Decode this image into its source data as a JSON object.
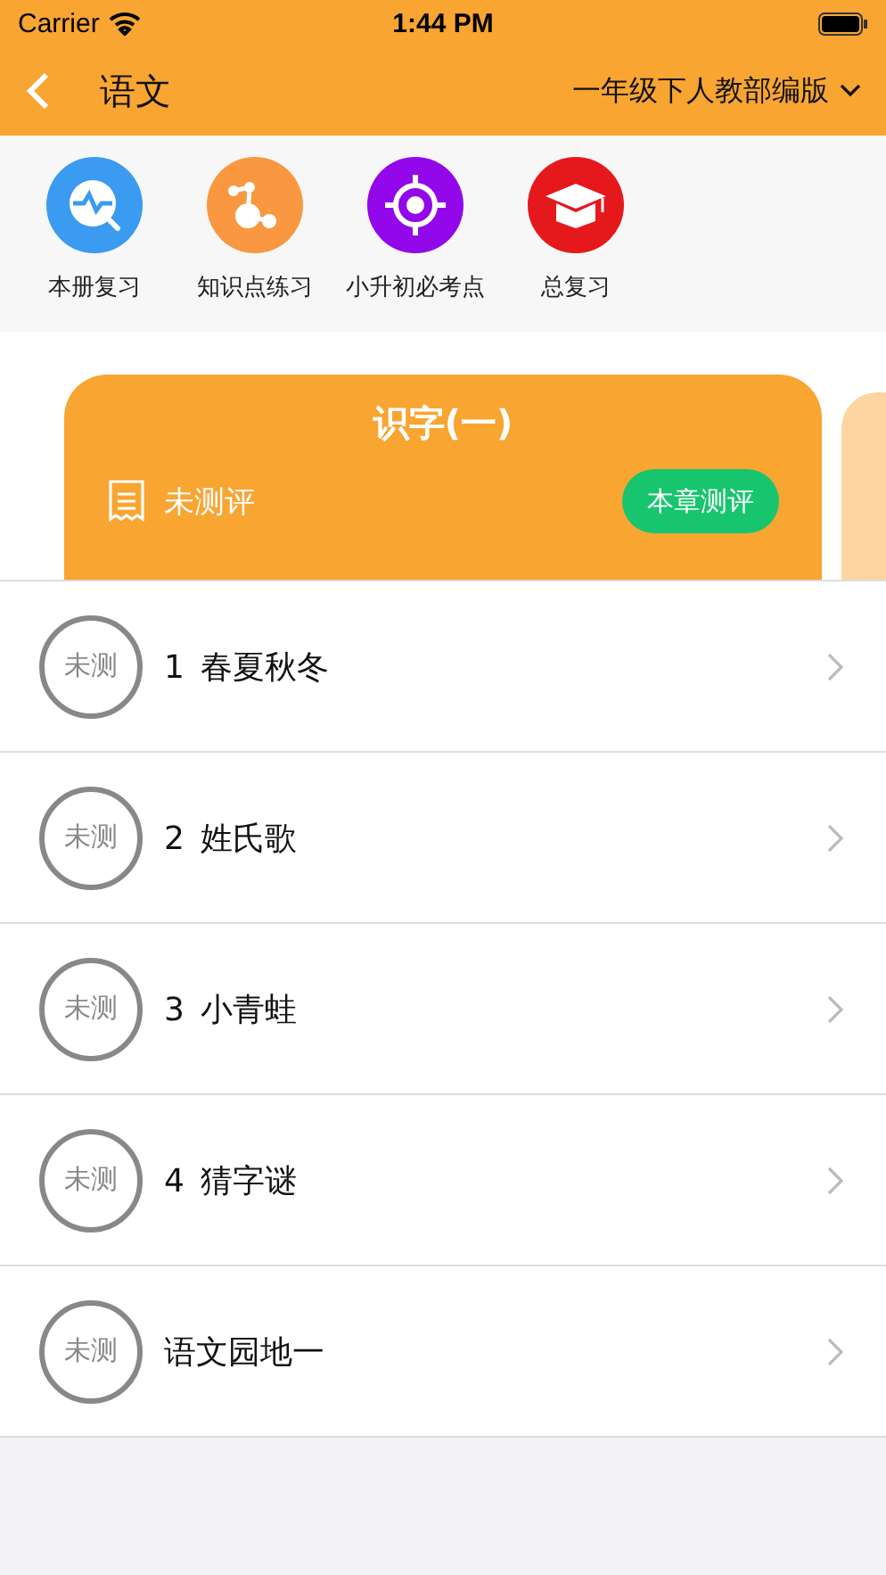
{
  "status_bar": {
    "carrier": "Carrier",
    "time": "1:44 PM"
  },
  "nav": {
    "title": "语文",
    "edition": "一年级下人教部编版"
  },
  "shortcuts": [
    {
      "kind": "review",
      "label": "本册复习"
    },
    {
      "kind": "practice",
      "label": "知识点练习"
    },
    {
      "kind": "target",
      "label": "小升初必考点"
    },
    {
      "kind": "graduation",
      "label": "总复习"
    }
  ],
  "chapter": {
    "title": "识字(一)",
    "status": "未测评",
    "button": "本章测评"
  },
  "lessons": [
    {
      "badge": "未测",
      "number": "1",
      "title": "春夏秋冬"
    },
    {
      "badge": "未测",
      "number": "2",
      "title": "姓氏歌"
    },
    {
      "badge": "未测",
      "number": "3",
      "title": "小青蛙"
    },
    {
      "badge": "未测",
      "number": "4",
      "title": "猜字谜"
    },
    {
      "badge": "未测",
      "title": "语文园地一"
    }
  ]
}
